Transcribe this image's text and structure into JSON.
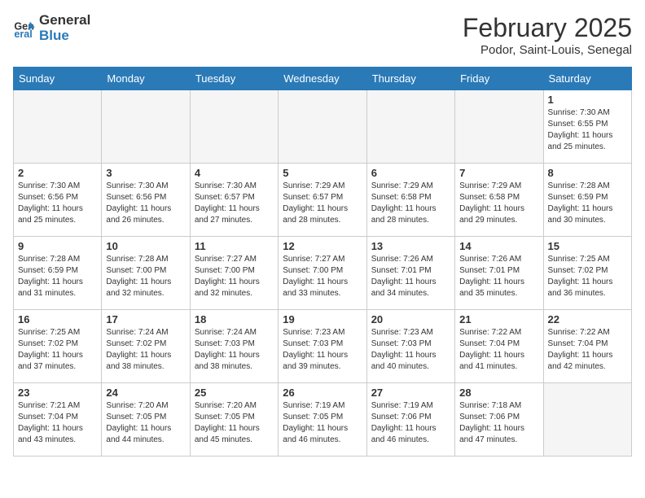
{
  "header": {
    "logo_general": "General",
    "logo_blue": "Blue",
    "month_title": "February 2025",
    "location": "Podor, Saint-Louis, Senegal"
  },
  "days_of_week": [
    "Sunday",
    "Monday",
    "Tuesday",
    "Wednesday",
    "Thursday",
    "Friday",
    "Saturday"
  ],
  "weeks": [
    [
      {
        "day": "",
        "info": "",
        "empty": true
      },
      {
        "day": "",
        "info": "",
        "empty": true
      },
      {
        "day": "",
        "info": "",
        "empty": true
      },
      {
        "day": "",
        "info": "",
        "empty": true
      },
      {
        "day": "",
        "info": "",
        "empty": true
      },
      {
        "day": "",
        "info": "",
        "empty": true
      },
      {
        "day": "1",
        "info": "Sunrise: 7:30 AM\nSunset: 6:55 PM\nDaylight: 11 hours\nand 25 minutes."
      }
    ],
    [
      {
        "day": "2",
        "info": "Sunrise: 7:30 AM\nSunset: 6:56 PM\nDaylight: 11 hours\nand 25 minutes."
      },
      {
        "day": "3",
        "info": "Sunrise: 7:30 AM\nSunset: 6:56 PM\nDaylight: 11 hours\nand 26 minutes."
      },
      {
        "day": "4",
        "info": "Sunrise: 7:30 AM\nSunset: 6:57 PM\nDaylight: 11 hours\nand 27 minutes."
      },
      {
        "day": "5",
        "info": "Sunrise: 7:29 AM\nSunset: 6:57 PM\nDaylight: 11 hours\nand 28 minutes."
      },
      {
        "day": "6",
        "info": "Sunrise: 7:29 AM\nSunset: 6:58 PM\nDaylight: 11 hours\nand 28 minutes."
      },
      {
        "day": "7",
        "info": "Sunrise: 7:29 AM\nSunset: 6:58 PM\nDaylight: 11 hours\nand 29 minutes."
      },
      {
        "day": "8",
        "info": "Sunrise: 7:28 AM\nSunset: 6:59 PM\nDaylight: 11 hours\nand 30 minutes."
      }
    ],
    [
      {
        "day": "9",
        "info": "Sunrise: 7:28 AM\nSunset: 6:59 PM\nDaylight: 11 hours\nand 31 minutes."
      },
      {
        "day": "10",
        "info": "Sunrise: 7:28 AM\nSunset: 7:00 PM\nDaylight: 11 hours\nand 32 minutes."
      },
      {
        "day": "11",
        "info": "Sunrise: 7:27 AM\nSunset: 7:00 PM\nDaylight: 11 hours\nand 32 minutes."
      },
      {
        "day": "12",
        "info": "Sunrise: 7:27 AM\nSunset: 7:00 PM\nDaylight: 11 hours\nand 33 minutes."
      },
      {
        "day": "13",
        "info": "Sunrise: 7:26 AM\nSunset: 7:01 PM\nDaylight: 11 hours\nand 34 minutes."
      },
      {
        "day": "14",
        "info": "Sunrise: 7:26 AM\nSunset: 7:01 PM\nDaylight: 11 hours\nand 35 minutes."
      },
      {
        "day": "15",
        "info": "Sunrise: 7:25 AM\nSunset: 7:02 PM\nDaylight: 11 hours\nand 36 minutes."
      }
    ],
    [
      {
        "day": "16",
        "info": "Sunrise: 7:25 AM\nSunset: 7:02 PM\nDaylight: 11 hours\nand 37 minutes."
      },
      {
        "day": "17",
        "info": "Sunrise: 7:24 AM\nSunset: 7:02 PM\nDaylight: 11 hours\nand 38 minutes."
      },
      {
        "day": "18",
        "info": "Sunrise: 7:24 AM\nSunset: 7:03 PM\nDaylight: 11 hours\nand 38 minutes."
      },
      {
        "day": "19",
        "info": "Sunrise: 7:23 AM\nSunset: 7:03 PM\nDaylight: 11 hours\nand 39 minutes."
      },
      {
        "day": "20",
        "info": "Sunrise: 7:23 AM\nSunset: 7:03 PM\nDaylight: 11 hours\nand 40 minutes."
      },
      {
        "day": "21",
        "info": "Sunrise: 7:22 AM\nSunset: 7:04 PM\nDaylight: 11 hours\nand 41 minutes."
      },
      {
        "day": "22",
        "info": "Sunrise: 7:22 AM\nSunset: 7:04 PM\nDaylight: 11 hours\nand 42 minutes."
      }
    ],
    [
      {
        "day": "23",
        "info": "Sunrise: 7:21 AM\nSunset: 7:04 PM\nDaylight: 11 hours\nand 43 minutes."
      },
      {
        "day": "24",
        "info": "Sunrise: 7:20 AM\nSunset: 7:05 PM\nDaylight: 11 hours\nand 44 minutes."
      },
      {
        "day": "25",
        "info": "Sunrise: 7:20 AM\nSunset: 7:05 PM\nDaylight: 11 hours\nand 45 minutes."
      },
      {
        "day": "26",
        "info": "Sunrise: 7:19 AM\nSunset: 7:05 PM\nDaylight: 11 hours\nand 46 minutes."
      },
      {
        "day": "27",
        "info": "Sunrise: 7:19 AM\nSunset: 7:06 PM\nDaylight: 11 hours\nand 46 minutes."
      },
      {
        "day": "28",
        "info": "Sunrise: 7:18 AM\nSunset: 7:06 PM\nDaylight: 11 hours\nand 47 minutes."
      },
      {
        "day": "",
        "info": "",
        "empty": true
      }
    ]
  ]
}
